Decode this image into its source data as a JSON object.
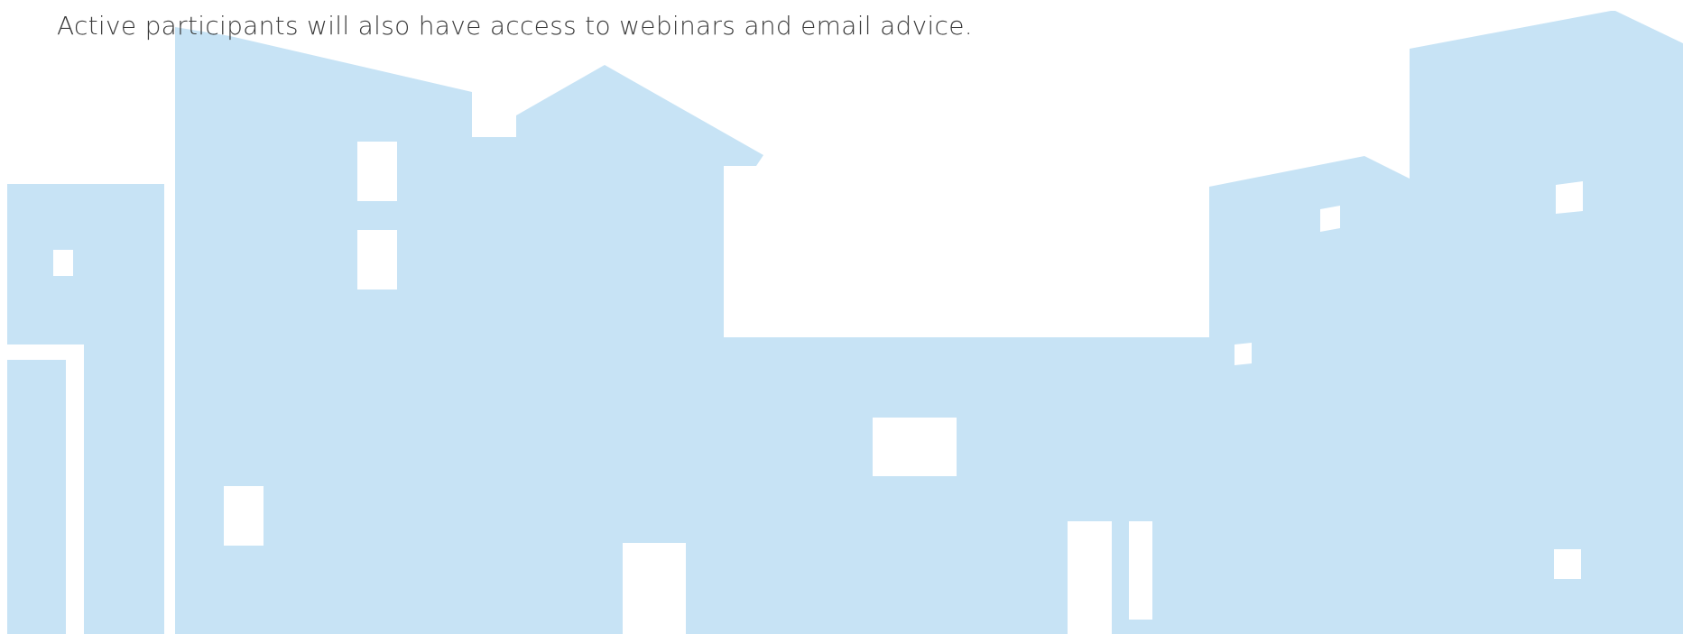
{
  "content": {
    "intro_text": "Active participants will also have access to webinars and email advice."
  },
  "illustration": {
    "name": "building-skyline-illustration",
    "building_color": "#c7e3f5",
    "window_color": "#ffffff"
  }
}
